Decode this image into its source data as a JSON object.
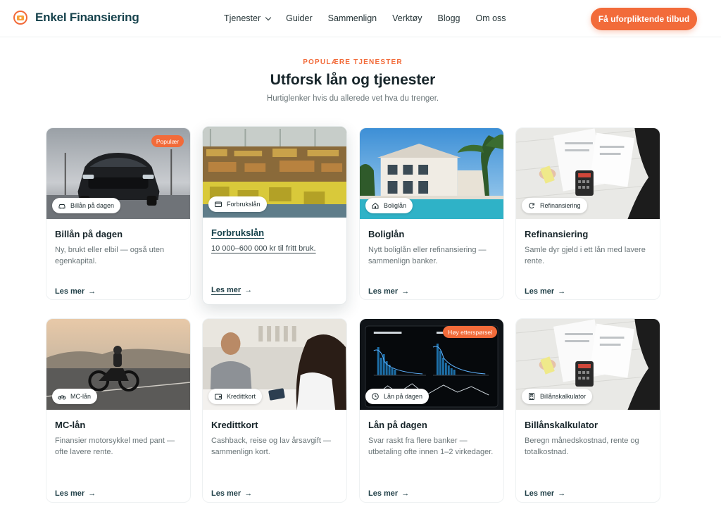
{
  "header": {
    "brand": "Enkel Finansiering",
    "nav": [
      "Tjenester",
      "Guider",
      "Sammenlign",
      "Verktøy",
      "Blogg",
      "Om oss"
    ],
    "cta": "Få uforpliktende tilbud"
  },
  "section": {
    "eyebrow": "POPULÆRE TJENESTER",
    "title": "Utforsk lån og tjenester",
    "subtitle": "Hurtiglenker hvis du allerede vet hva du trenger."
  },
  "cards": [
    {
      "tag": "Billån på dagen",
      "tag_icon": "car-icon",
      "title": "Billån på dagen",
      "desc": "Ny, brukt eller elbil — også uten egenkapital.",
      "link": "Les mer",
      "badge": "Populær"
    },
    {
      "tag": "Forbrukslån",
      "tag_icon": "credit-card-icon",
      "title": "Forbrukslån",
      "desc": "10 000–600 000 kr til fritt bruk.",
      "link": "Les mer",
      "badge": ""
    },
    {
      "tag": "Boliglån",
      "tag_icon": "home-icon",
      "title": "Boliglån",
      "desc": "Nytt boliglån eller refinansiering — sammenlign banker.",
      "link": "Les mer",
      "badge": ""
    },
    {
      "tag": "Refinansiering",
      "tag_icon": "refresh-icon",
      "title": "Refinansiering",
      "desc": "Samle dyr gjeld i ett lån med lavere rente.",
      "link": "Les mer",
      "badge": ""
    },
    {
      "tag": "MC-lån",
      "tag_icon": "motorcycle-icon",
      "title": "MC-lån",
      "desc": "Finansier motorsykkel med pant — ofte lavere rente.",
      "link": "Les mer",
      "badge": ""
    },
    {
      "tag": "Kredittkort",
      "tag_icon": "wallet-icon",
      "title": "Kredittkort",
      "desc": "Cashback, reise og lav årsavgift — sammenlign kort.",
      "link": "Les mer",
      "badge": ""
    },
    {
      "tag": "Lån på dagen",
      "tag_icon": "clock-icon",
      "title": "Lån på dagen",
      "desc": "Svar raskt fra flere banker — utbetaling ofte innen 1–2 virkedager.",
      "link": "Les mer",
      "badge": "Høy etterspørsel"
    },
    {
      "tag": "Billånskalkulator",
      "tag_icon": "calculator-icon",
      "title": "Billånskalkulator",
      "desc": "Beregn månedskostnad, rente og totalkostnad.",
      "link": "Les mer",
      "badge": ""
    }
  ],
  "colors": {
    "accent": "#f26b3a",
    "brand": "#16424c"
  }
}
